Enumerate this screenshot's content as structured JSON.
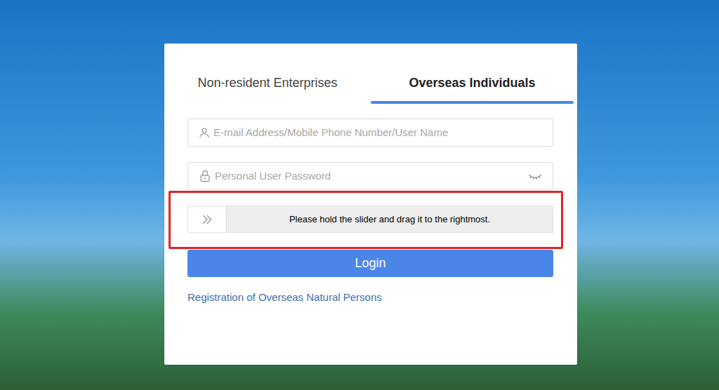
{
  "tabs": [
    {
      "label": "Non-resident Enterprises",
      "selected": false
    },
    {
      "label": "Overseas Individuals",
      "selected": true
    }
  ],
  "fields": [
    {
      "placeholder": "E-mail Address/Mobile Phone Number/User Name",
      "kind": "user"
    },
    {
      "placeholder": "Personal User Password",
      "kind": "password"
    }
  ],
  "slider": {
    "hint": "Please hold the slider and drag it to the rightmost.",
    "level": 0
  },
  "login_button": "Login",
  "register_link": "Registration of Overseas Natural Persons"
}
